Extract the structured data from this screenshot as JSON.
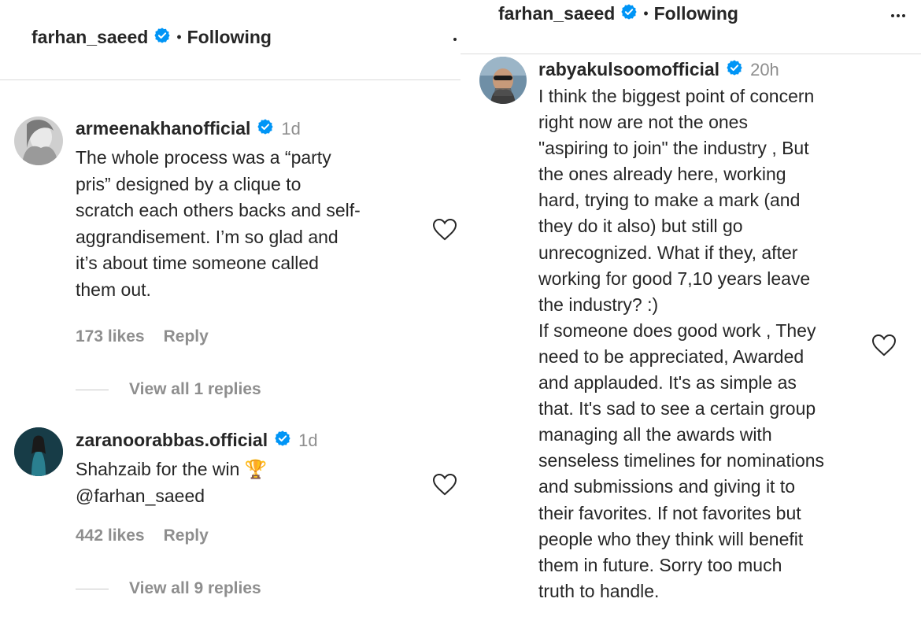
{
  "left": {
    "header": {
      "username": "farhan_saeed",
      "separator": "•",
      "follow_status": "Following"
    },
    "comments": [
      {
        "username": "armeenakhanofficial",
        "time": "1d",
        "text": "The whole process was a “party\npris” designed by a clique to\nscratch each others backs and self-\naggrandisement. I’m so glad and\nit’s about time someone called\nthem out.",
        "likes": "173 likes",
        "reply_label": "Reply",
        "view_replies": "View all 1 replies"
      },
      {
        "username": "zaranoorabbas.official",
        "time": "1d",
        "text": "Shahzaib for the win 🏆\n@farhan_saeed",
        "likes": "442 likes",
        "reply_label": "Reply",
        "view_replies": "View all 9 replies"
      }
    ]
  },
  "right": {
    "header": {
      "username": "farhan_saeed",
      "separator": "•",
      "follow_status": "Following"
    },
    "comment": {
      "username": "rabyakulsoomofficial",
      "time": "20h",
      "text": "I think the biggest point of concern\nright now are not the ones\n\"aspiring to join\" the industry , But\nthe ones already here, working\nhard, trying to make a mark (and\nthey do it also) but still go\nunrecognized. What if they, after\nworking for good 7,10 years leave\nthe industry? :)\nIf someone does good work , They\nneed to be appreciated, Awarded\nand applauded. It's as simple as\nthat. It's sad to see a certain group\nmanaging all the awards with\nsenseless timelines for nominations\nand submissions and giving it to\ntheir favorites. If not favorites but\npeople who they think will benefit\nthem in future. Sorry too much\ntruth to handle."
    }
  },
  "colors": {
    "verified": "#0095f6",
    "text": "#262626",
    "muted": "#8e8e8e",
    "divider": "#dbdbdb"
  },
  "icons": [
    "verified-badge-icon",
    "heart-icon",
    "more-options-icon",
    "trophy-emoji"
  ]
}
